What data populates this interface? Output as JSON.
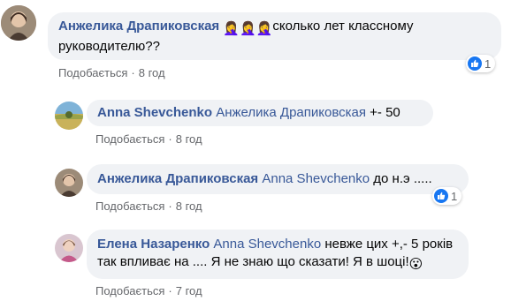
{
  "comments": [
    {
      "author": "Анжелика Драпиковская",
      "emoji": "🤦‍♀️🤦‍♀️🤦‍♀️",
      "text_line1": "сколько лет классному",
      "text_line2": "руководителю??",
      "like_label": "Подобається",
      "time": "8 год",
      "reaction_count": "1"
    },
    {
      "author": "Anna Shevchenko",
      "mention": "Анжелика Драпиковская",
      "text": "+- 50",
      "like_label": "Подобається",
      "time": "8 год"
    },
    {
      "author": "Анжелика Драпиковская",
      "mention": "Anna Shevchenko",
      "text": "до н.э .....",
      "like_label": "Подобається",
      "time": "8 год",
      "reaction_count": "1"
    },
    {
      "author": "Елена Назаренко",
      "mention": "Anna Shevchenko",
      "text_line1": "невже цих +,- 5 років",
      "text_line2": "так впливає на .... Я не знаю що сказати! Я в шоці!",
      "emoji": "😮",
      "like_label": "Подобається",
      "time": "7 год"
    }
  ],
  "colors": {
    "author": "#385898",
    "bubble": "#f0f2f5",
    "meta": "#65676b",
    "like": "#1877f2"
  },
  "icons": {
    "like": "thumbs-up-icon"
  }
}
